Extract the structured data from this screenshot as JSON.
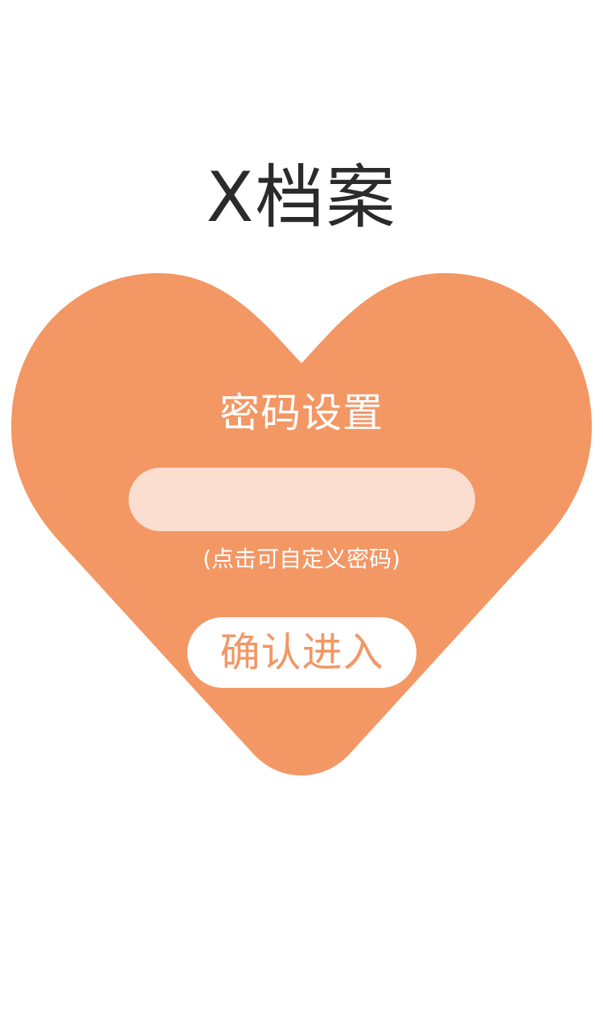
{
  "app": {
    "title": "X档案"
  },
  "password_setup": {
    "title": "密码设置",
    "input_value": "",
    "input_placeholder": "",
    "hint": "(点击可自定义密码)",
    "confirm_label": "确认进入"
  },
  "colors": {
    "accent": "#f39764",
    "input_background": "#fbdecf",
    "title_text": "#2b2b2b",
    "background": "#ffffff"
  },
  "icons": {
    "heart": "heart-icon"
  }
}
